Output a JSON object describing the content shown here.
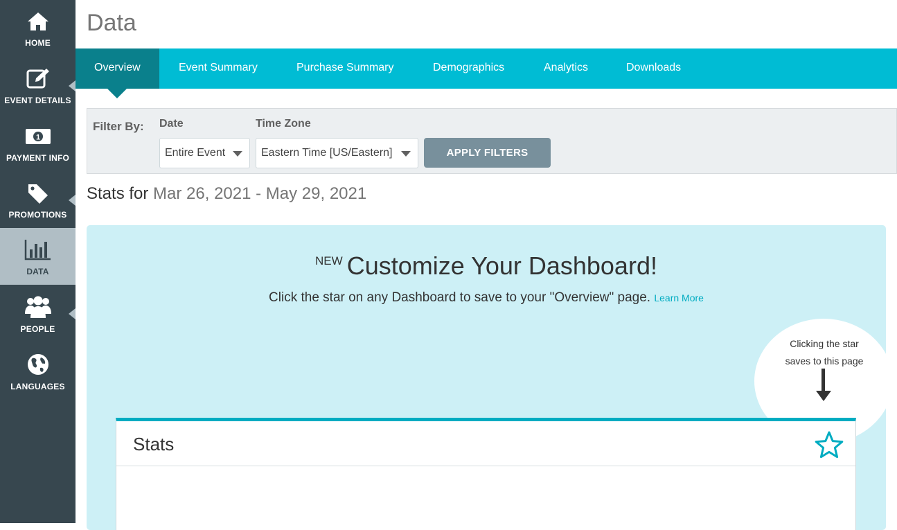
{
  "sidebar": {
    "items": [
      {
        "label": "HOME",
        "icon": "home-icon"
      },
      {
        "label": "EVENT DETAILS",
        "icon": "edit-icon"
      },
      {
        "label": "PAYMENT INFO",
        "icon": "money-icon"
      },
      {
        "label": "PROMOTIONS",
        "icon": "tag-icon"
      },
      {
        "label": "DATA",
        "icon": "bar-chart-icon",
        "active": true
      },
      {
        "label": "PEOPLE",
        "icon": "people-icon"
      },
      {
        "label": "LANGUAGES",
        "icon": "globe-icon"
      }
    ]
  },
  "page": {
    "title": "Data"
  },
  "tabs": [
    {
      "label": "Overview",
      "active": true
    },
    {
      "label": "Event Summary"
    },
    {
      "label": "Purchase Summary"
    },
    {
      "label": "Demographics"
    },
    {
      "label": "Analytics"
    },
    {
      "label": "Downloads"
    }
  ],
  "filter": {
    "by_label": "Filter By:",
    "date_label": "Date",
    "date_value": "Entire Event",
    "timezone_label": "Time Zone",
    "timezone_value": "Eastern Time [US/Eastern]",
    "apply_label": "APPLY FILTERS"
  },
  "stats": {
    "prefix": "Stats for",
    "range": "Mar 26, 2021 - May 29, 2021"
  },
  "promo": {
    "new_label": "NEW",
    "headline": "Customize Your Dashboard!",
    "subtext": "Click the star on any Dashboard to save to your \"Overview\" page.",
    "learn_more": "Learn More",
    "bubble_line1": "Clicking the star",
    "bubble_line2": "saves to this page"
  },
  "card": {
    "title": "Stats"
  },
  "colors": {
    "sidebar": "#37474f",
    "sidebar_active": "#b0bec5",
    "tabbar": "#00bcd4",
    "tab_active": "#0a808c",
    "accent": "#00acc1",
    "promo_bg": "#cdf0f6"
  }
}
